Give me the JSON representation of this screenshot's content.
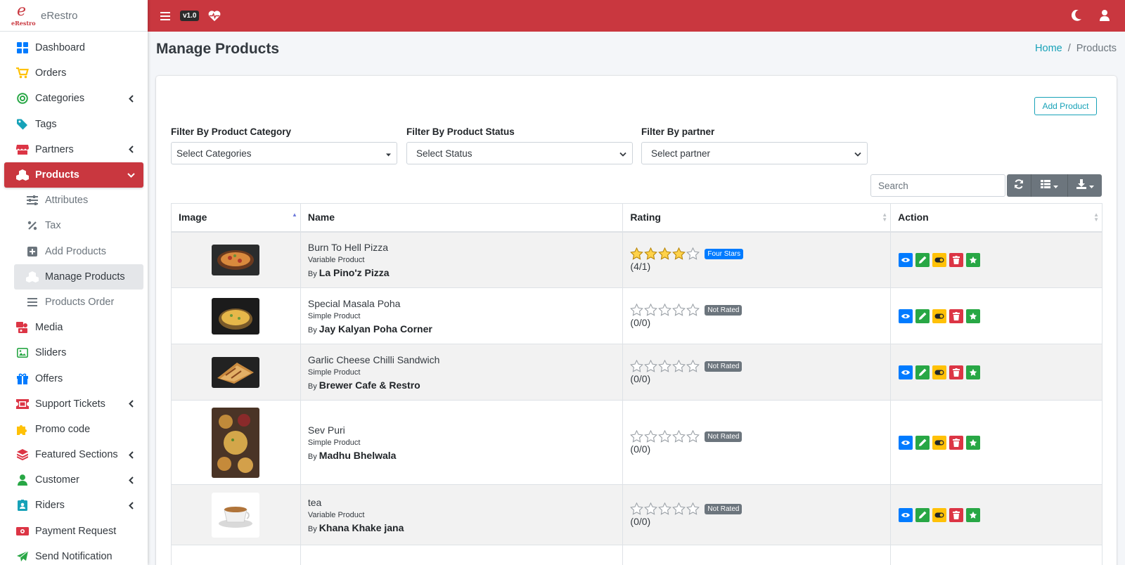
{
  "brand": {
    "logo_text": "eRestro",
    "name": "eRestro"
  },
  "sidebar": {
    "items": [
      {
        "label": "Dashboard",
        "icon": "dashboard-icon"
      },
      {
        "label": "Orders",
        "icon": "cart-icon"
      },
      {
        "label": "Categories",
        "icon": "bullseye-icon",
        "has_submenu": true
      },
      {
        "label": "Tags",
        "icon": "tag-icon"
      },
      {
        "label": "Partners",
        "icon": "store-icon",
        "has_submenu": true
      },
      {
        "label": "Products",
        "icon": "cubes-icon",
        "active": true
      },
      {
        "label": "Attributes",
        "icon": "sliders-icon",
        "sub": true
      },
      {
        "label": "Tax",
        "icon": "percent-icon",
        "sub": true
      },
      {
        "label": "Add Products",
        "icon": "plus-square-icon",
        "sub": true
      },
      {
        "label": "Manage Products",
        "icon": "cubes-icon",
        "sub": true,
        "current": true
      },
      {
        "label": "Products Order",
        "icon": "list-icon",
        "sub": true
      },
      {
        "label": "Media",
        "icon": "photo-video-icon"
      },
      {
        "label": "Sliders",
        "icon": "image-icon"
      },
      {
        "label": "Offers",
        "icon": "gift-icon"
      },
      {
        "label": "Support Tickets",
        "icon": "ticket-icon",
        "has_submenu": true
      },
      {
        "label": "Promo code",
        "icon": "puzzle-icon"
      },
      {
        "label": "Featured Sections",
        "icon": "layers-icon",
        "has_submenu": true
      },
      {
        "label": "Customer",
        "icon": "user-icon",
        "has_submenu": true
      },
      {
        "label": "Riders",
        "icon": "id-badge-icon",
        "has_submenu": true
      },
      {
        "label": "Payment Request",
        "icon": "money-icon"
      },
      {
        "label": "Send Notification",
        "icon": "paper-plane-icon"
      }
    ]
  },
  "topbar": {
    "version": "v1.0",
    "accent": "#c9373f"
  },
  "page": {
    "title": "Manage Products"
  },
  "breadcrumb": {
    "home": "Home",
    "sep": "/",
    "current": "Products"
  },
  "toolbar": {
    "add_label": "Add Product",
    "search_placeholder": "Search"
  },
  "filters": [
    {
      "label": "Filter By Product Category",
      "value": "Select Categories"
    },
    {
      "label": "Filter By Product Status",
      "value": "Select Status"
    },
    {
      "label": "Filter By partner",
      "value": "Select partner"
    }
  ],
  "table": {
    "headers": [
      "Image",
      "Name",
      "Rating",
      "Action"
    ],
    "rows": [
      {
        "name": "Burn To Hell Pizza",
        "type": "Variable Product",
        "by": "By",
        "partner": "La Pino'z Pizza",
        "stars": 4,
        "badge": "Four Stars",
        "rating_text": "(4/1)",
        "thumb": "pizza"
      },
      {
        "name": "Special Masala Poha",
        "type": "Simple Product",
        "by": "By",
        "partner": "Jay Kalyan Poha Corner",
        "stars": 0,
        "badge": "Not Rated",
        "rating_text": "(0/0)",
        "thumb": "poha"
      },
      {
        "name": "Garlic Cheese Chilli Sandwich",
        "type": "Simple Product",
        "by": "By",
        "partner": "Brewer Cafe & Restro",
        "stars": 0,
        "badge": "Not Rated",
        "rating_text": "(0/0)",
        "thumb": "sandwich"
      },
      {
        "name": "Sev Puri",
        "type": "Simple Product",
        "by": "By",
        "partner": "Madhu Bhelwala",
        "stars": 0,
        "badge": "Not Rated",
        "rating_text": "(0/0)",
        "thumb": "sevpuri"
      },
      {
        "name": "tea",
        "type": "Variable Product",
        "by": "By",
        "partner": "Khana Khake jana",
        "stars": 0,
        "badge": "Not Rated",
        "rating_text": "(0/0)",
        "thumb": "tea"
      }
    ]
  }
}
